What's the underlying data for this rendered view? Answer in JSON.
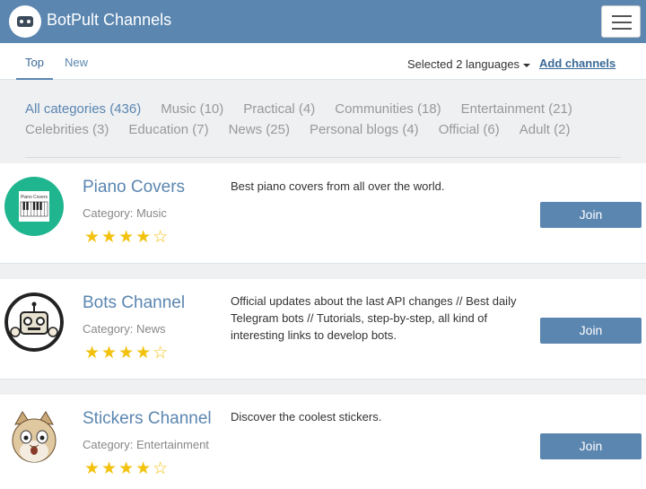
{
  "app": {
    "title": "BotPult Channels"
  },
  "tabs": [
    {
      "label": "Top",
      "active": true
    },
    {
      "label": "New",
      "active": false
    }
  ],
  "toolbar": {
    "language_filter": "Selected 2 languages",
    "add_channels": "Add channels"
  },
  "categories": {
    "row1": [
      "All categories (436)",
      "Music (10)",
      "Practical (4)",
      "Communities (18)",
      "Entertainment (21)"
    ],
    "row2": [
      "Celebrities (3)",
      "Education (7)",
      "News (25)",
      "Personal blogs (4)",
      "Official (6)",
      "Adult (2)"
    ],
    "active": "All categories (436)"
  },
  "channels": [
    {
      "name": "Piano Covers",
      "category": "Category: Music",
      "rating": 4,
      "stars": "★★★★☆",
      "description": "Best piano covers from all over the world.",
      "avatar_text": "Piano Covers",
      "join_label": "Join"
    },
    {
      "name": "Bots Channel",
      "category": "Category: News",
      "rating": 4,
      "stars": "★★★★☆",
      "description": "Official updates about the last API changes // Best daily Telegram bots // Tutorials, step-by-step, all kind of interesting links to develop bots.",
      "join_label": "Join"
    },
    {
      "name": "Stickers Channel",
      "category": "Category: Entertainment",
      "rating": 4,
      "stars": "★★★★☆",
      "description": "Discover the coolest stickers.",
      "join_label": "Join"
    }
  ],
  "colors": {
    "navbar": "#5b86b0",
    "accent": "#5b86b0",
    "star": "#f2c20f",
    "piano_avatar": "#1fb58f"
  }
}
